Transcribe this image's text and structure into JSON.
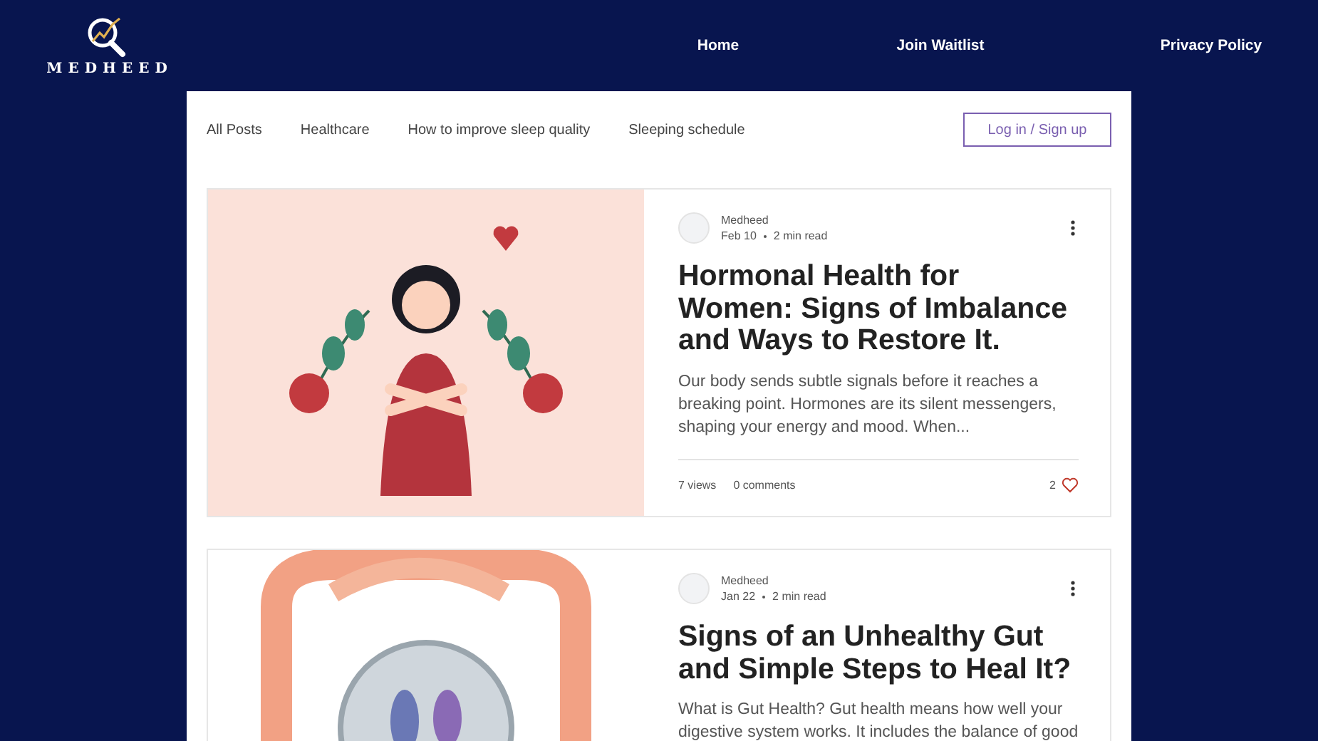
{
  "header": {
    "logo_text": "MEDHEED",
    "nav": [
      {
        "label": "Home"
      },
      {
        "label": "Join Waitlist"
      },
      {
        "label": "Privacy Policy"
      }
    ]
  },
  "categories": [
    {
      "label": "All Posts"
    },
    {
      "label": "Healthcare"
    },
    {
      "label": "How to improve sleep quality"
    },
    {
      "label": "Sleeping schedule"
    }
  ],
  "login_button": "Log in / Sign up",
  "posts": [
    {
      "author": "Medheed",
      "date": "Feb 10",
      "read_time": "2 min read",
      "title": "Hormonal Health for Women: Signs of Imbalance and Ways to Restore It.",
      "excerpt": "Our body sends subtle signals before it reaches a breaking point. Hormones are its silent messengers, shaping your energy and mood. When...",
      "views": "7 views",
      "comments": "0 comments",
      "likes": "2"
    },
    {
      "author": "Medheed",
      "date": "Jan 22",
      "read_time": "2 min read",
      "title": "Signs of an Unhealthy Gut and Simple Steps to Heal It?",
      "excerpt": "What is Gut Health? Gut health means how well your digestive system works. It includes the balance of good"
    }
  ]
}
